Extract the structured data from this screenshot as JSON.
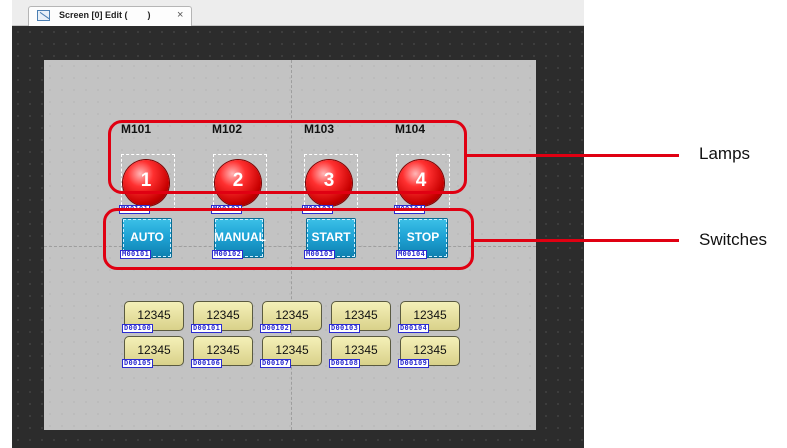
{
  "tab": {
    "title": "Screen [0] Edit (        )",
    "close": "×"
  },
  "m_labels": [
    "M101",
    "M102",
    "M103",
    "M104"
  ],
  "lamps": [
    {
      "number": "1",
      "address": "M00101"
    },
    {
      "number": "2",
      "address": "M00102"
    },
    {
      "number": "3",
      "address": "M00103"
    },
    {
      "number": "4",
      "address": "M00104"
    }
  ],
  "switches": [
    {
      "label": "AUTO",
      "address": "M00101"
    },
    {
      "label": "MANUAL",
      "address": "M00102"
    },
    {
      "label": "START",
      "address": "M00103"
    },
    {
      "label": "STOP",
      "address": "M00104"
    }
  ],
  "numeric_displays": [
    {
      "value": "12345",
      "address": "D00100"
    },
    {
      "value": "12345",
      "address": "D00101"
    },
    {
      "value": "12345",
      "address": "D00102"
    },
    {
      "value": "12345",
      "address": "D00103"
    },
    {
      "value": "12345",
      "address": "D00104"
    },
    {
      "value": "12345",
      "address": "D00105"
    },
    {
      "value": "12345",
      "address": "D00106"
    },
    {
      "value": "12345",
      "address": "D00107"
    },
    {
      "value": "12345",
      "address": "D00108"
    },
    {
      "value": "12345",
      "address": "D00109"
    }
  ],
  "callouts": {
    "lamps": "Lamps",
    "switches": "Switches"
  },
  "colors": {
    "highlight": "#e00012",
    "lamp": "#e00000",
    "switch": "#1fa4d6",
    "numeric": "#e8e2a4",
    "address_tag": "#2b2bd0"
  }
}
